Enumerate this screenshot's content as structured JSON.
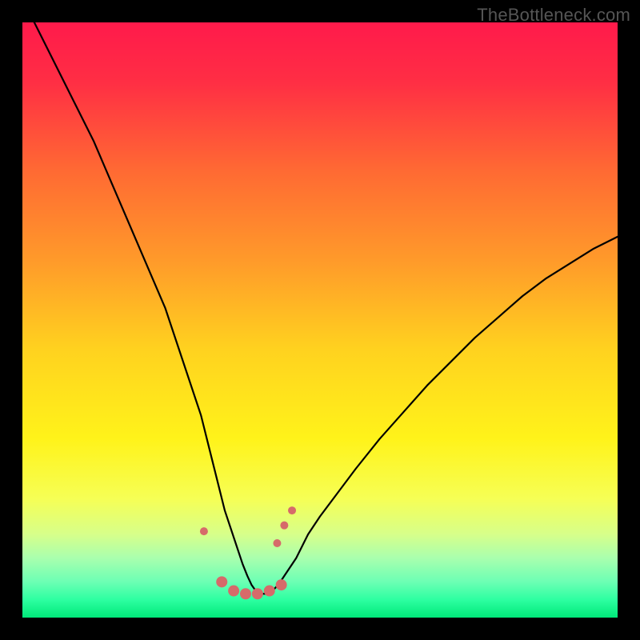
{
  "watermark": "TheBottleneck.com",
  "chart_data": {
    "type": "line",
    "title": "",
    "xlabel": "",
    "ylabel": "",
    "xlim": [
      0,
      100
    ],
    "ylim": [
      0,
      100
    ],
    "gradient_stops": [
      {
        "offset": 0.0,
        "color": "#ff1a4b"
      },
      {
        "offset": 0.1,
        "color": "#ff2e44"
      },
      {
        "offset": 0.25,
        "color": "#ff6a33"
      },
      {
        "offset": 0.4,
        "color": "#ff9a2a"
      },
      {
        "offset": 0.55,
        "color": "#ffd21f"
      },
      {
        "offset": 0.7,
        "color": "#fff31a"
      },
      {
        "offset": 0.8,
        "color": "#f6ff55"
      },
      {
        "offset": 0.86,
        "color": "#d7ff8a"
      },
      {
        "offset": 0.9,
        "color": "#a9ffae"
      },
      {
        "offset": 0.94,
        "color": "#6cffb4"
      },
      {
        "offset": 0.97,
        "color": "#2dffa1"
      },
      {
        "offset": 1.0,
        "color": "#00e879"
      }
    ],
    "series": [
      {
        "name": "bottleneck-curve",
        "color": "#000000",
        "width": 2.2,
        "x": [
          0,
          3,
          6,
          9,
          12,
          15,
          18,
          21,
          24,
          26,
          28,
          30,
          31,
          32,
          33,
          34,
          35,
          36,
          37,
          37.8,
          38.5,
          39.2,
          40,
          41,
          42,
          43,
          44,
          46,
          48,
          50,
          53,
          56,
          60,
          64,
          68,
          72,
          76,
          80,
          84,
          88,
          92,
          96,
          100
        ],
        "values": [
          104,
          98,
          92,
          86,
          80,
          73,
          66,
          59,
          52,
          46,
          40,
          34,
          30,
          26,
          22,
          18,
          15,
          12,
          9,
          7,
          5.5,
          4.5,
          4,
          4,
          4.5,
          5.5,
          7,
          10,
          14,
          17,
          21,
          25,
          30,
          34.5,
          39,
          43,
          47,
          50.5,
          54,
          57,
          59.5,
          62,
          64
        ]
      }
    ],
    "markers": {
      "color": "#d66a6a",
      "small_radius": 5,
      "large_radius": 7,
      "points": [
        {
          "x": 30.5,
          "y": 14.5,
          "r": "small"
        },
        {
          "x": 33.5,
          "y": 6.0,
          "r": "large"
        },
        {
          "x": 35.5,
          "y": 4.5,
          "r": "large"
        },
        {
          "x": 37.5,
          "y": 4.0,
          "r": "large"
        },
        {
          "x": 39.5,
          "y": 4.0,
          "r": "large"
        },
        {
          "x": 41.5,
          "y": 4.5,
          "r": "large"
        },
        {
          "x": 43.5,
          "y": 5.5,
          "r": "large"
        },
        {
          "x": 42.8,
          "y": 12.5,
          "r": "small"
        },
        {
          "x": 44.0,
          "y": 15.5,
          "r": "small"
        },
        {
          "x": 45.3,
          "y": 18.0,
          "r": "small"
        }
      ]
    }
  }
}
